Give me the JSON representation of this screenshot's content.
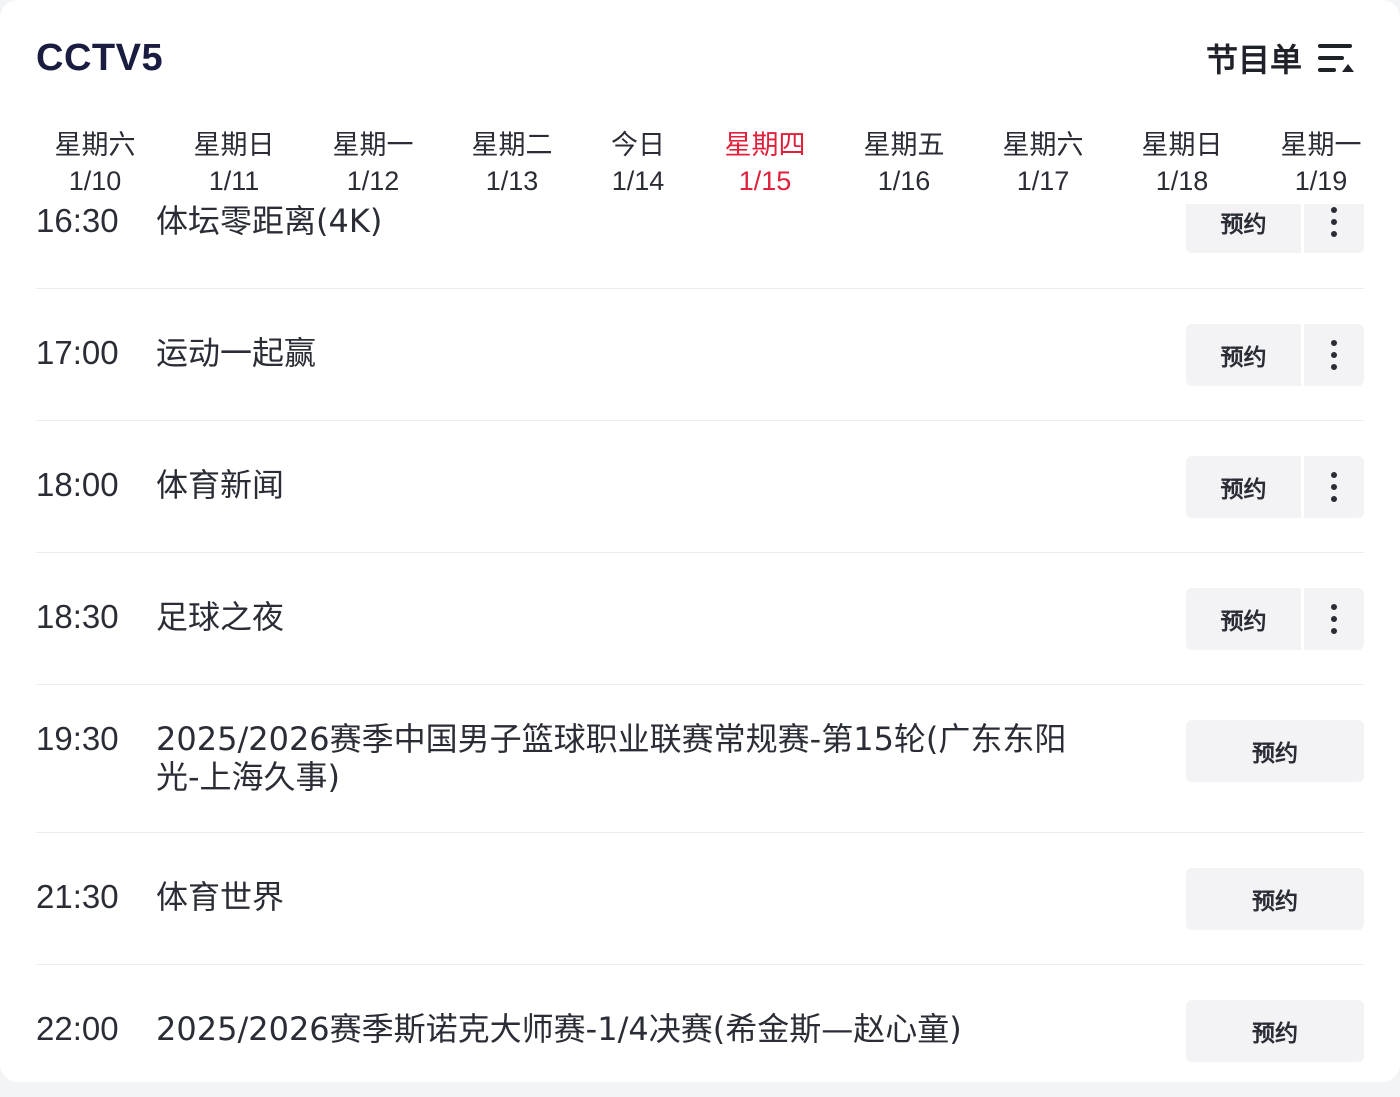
{
  "header": {
    "channel": "CCTV5",
    "menu_label": "节目单",
    "menu_icon": "list-sort-icon"
  },
  "dates": [
    {
      "weekday": "星期六",
      "date": "1/10"
    },
    {
      "weekday": "星期日",
      "date": "1/11"
    },
    {
      "weekday": "星期一",
      "date": "1/12"
    },
    {
      "weekday": "星期二",
      "date": "1/13"
    },
    {
      "weekday": "今日",
      "date": "1/14"
    },
    {
      "weekday": "星期四",
      "date": "1/15",
      "active": true
    },
    {
      "weekday": "星期五",
      "date": "1/16"
    },
    {
      "weekday": "星期六",
      "date": "1/17"
    },
    {
      "weekday": "星期日",
      "date": "1/18"
    },
    {
      "weekday": "星期一",
      "date": "1/19"
    }
  ],
  "active_color": "#e0213c",
  "programs": [
    {
      "time": "16:30",
      "title": "体坛零距离(4K)",
      "reserve_label": "预约",
      "has_more": true
    },
    {
      "time": "17:00",
      "title": "运动一起赢",
      "reserve_label": "预约",
      "has_more": true
    },
    {
      "time": "18:00",
      "title": "体育新闻",
      "reserve_label": "预约",
      "has_more": true
    },
    {
      "time": "18:30",
      "title": "足球之夜",
      "reserve_label": "预约",
      "has_more": true
    },
    {
      "time": "19:30",
      "title": "2025/2026赛季中国男子篮球职业联赛常规赛-第15轮(广东东阳光-上海久事)",
      "reserve_label": "预约",
      "has_more": false
    },
    {
      "time": "21:30",
      "title": "体育世界",
      "reserve_label": "预约",
      "has_more": false
    },
    {
      "time": "22:00",
      "title": "2025/2026赛季斯诺克大师赛-1/4决赛(希金斯—赵心童)",
      "reserve_label": "预约",
      "has_more": false
    }
  ]
}
